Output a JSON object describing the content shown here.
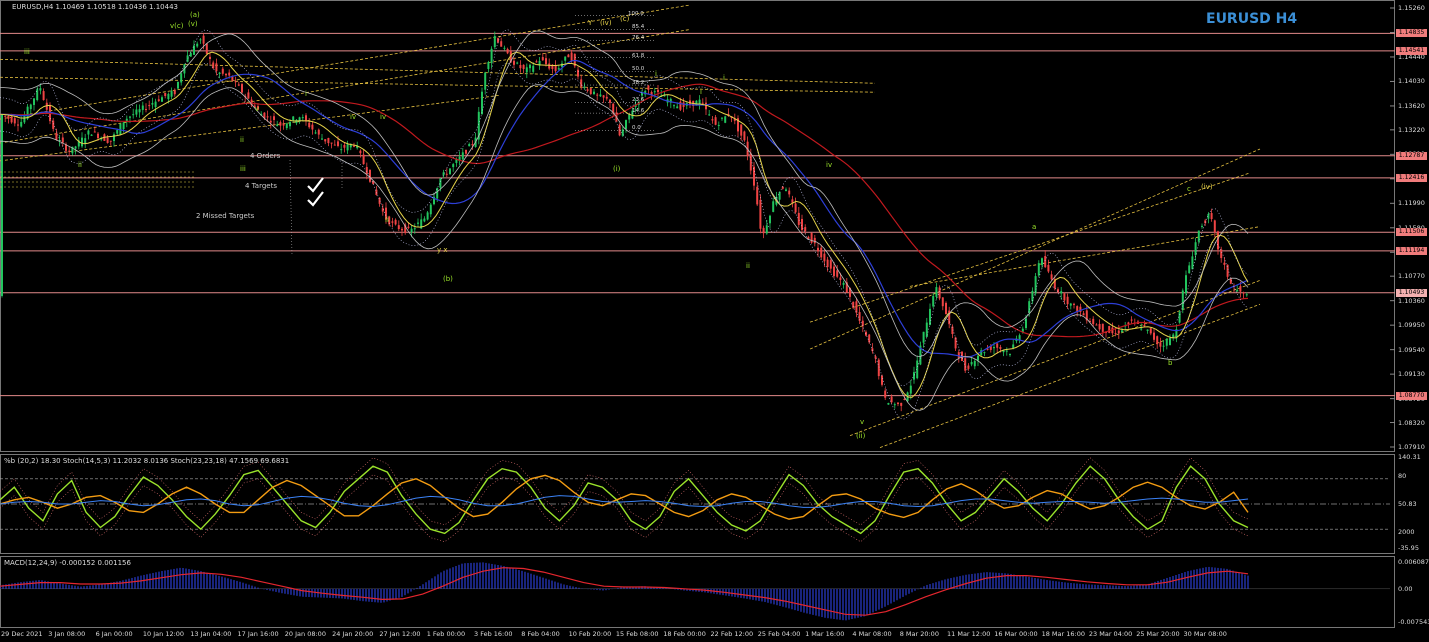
{
  "header": {
    "info": "EURUSD,H4  1.10469 1.10518 1.10436 1.10443",
    "symbol_title": "EURUSD H4"
  },
  "colors": {
    "background": "#000000",
    "bull_candle": "#22c55e",
    "bear_candle": "#ef4444",
    "ma_red": "#c0191e",
    "ma_blue": "#2d3fd8",
    "ma_yellow": "#e5d34a",
    "bollinger": "#bdbdbd",
    "level_line": "#e28a8a",
    "channel": "#e5c040",
    "stoch_main": "#9be32b",
    "stoch_signal": "#f39c12",
    "macd_hist": "#2a3cd0",
    "macd_signal": "#e5262e"
  },
  "chart_data": [
    {
      "type": "candlestick",
      "name": "EURUSD,H4",
      "y_ticks": [
        "1.15260",
        "1.14850",
        "1.14440",
        "1.14030",
        "1.13620",
        "1.13220",
        "1.12810",
        "1.12400",
        "1.11990",
        "1.11580",
        "1.11170",
        "1.10770",
        "1.10360",
        "1.09950",
        "1.09540",
        "1.09130",
        "1.08720",
        "1.08320",
        "1.07910"
      ],
      "ylim": [
        1.0786,
        1.1531
      ],
      "x_ticks": [
        "29 Dec 2021",
        "3 Jan 08:00",
        "6 Jan 00:00",
        "10 Jan 12:00",
        "13 Jan 04:00",
        "17 Jan 16:00",
        "20 Jan 08:00",
        "24 Jan 20:00",
        "27 Jan 12:00",
        "1 Feb 00:00",
        "3 Feb 16:00",
        "8 Feb 04:00",
        "10 Feb 20:00",
        "15 Feb 08:00",
        "18 Feb 00:00",
        "22 Feb 12:00",
        "25 Feb 04:00",
        "1 Mar 16:00",
        "4 Mar 08:00",
        "8 Mar 20:00",
        "11 Mar 12:00",
        "16 Mar 00:00",
        "18 Mar 16:00",
        "23 Mar 04:00",
        "25 Mar 20:00",
        "30 Mar 08:00"
      ],
      "price_tags": [
        {
          "label": "1.14835",
          "value": 1.14835
        },
        {
          "label": "1.14541",
          "value": 1.14541
        },
        {
          "label": "1.12787",
          "value": 1.12787
        },
        {
          "label": "1.12416",
          "value": 1.12416
        },
        {
          "label": "1.11506",
          "value": 1.11506
        },
        {
          "label": "1.11194",
          "value": 1.11194
        },
        {
          "label": "1.10493",
          "value": 1.10493
        },
        {
          "label": "1.08770",
          "value": 1.0877
        }
      ],
      "fib_levels": [
        {
          "label": "100.0",
          "value": 1.1513
        },
        {
          "label": "85.4",
          "value": 1.149
        },
        {
          "label": "76.4",
          "value": 1.1472
        },
        {
          "label": "61.8",
          "value": 1.1443
        },
        {
          "label": "50.0",
          "value": 1.142
        },
        {
          "label": "38.2",
          "value": 1.1397
        },
        {
          "label": "23.6",
          "value": 1.1368
        },
        {
          "label": "14.6",
          "value": 1.135
        },
        {
          "label": "0.0",
          "value": 1.1321
        }
      ],
      "close_path": [
        [
          0,
          1.1348
        ],
        [
          20,
          1.1332
        ],
        [
          40,
          1.1395
        ],
        [
          55,
          1.131
        ],
        [
          70,
          1.1285
        ],
        [
          90,
          1.132
        ],
        [
          110,
          1.1302
        ],
        [
          125,
          1.134
        ],
        [
          140,
          1.1355
        ],
        [
          160,
          1.1375
        ],
        [
          175,
          1.1385
        ],
        [
          185,
          1.144
        ],
        [
          200,
          1.1475
        ],
        [
          215,
          1.142
        ],
        [
          230,
          1.141
        ],
        [
          245,
          1.138
        ],
        [
          260,
          1.135
        ],
        [
          280,
          1.133
        ],
        [
          300,
          1.1345
        ],
        [
          320,
          1.131
        ],
        [
          340,
          1.129
        ],
        [
          355,
          1.13
        ],
        [
          370,
          1.124
        ],
        [
          385,
          1.1175
        ],
        [
          395,
          1.116
        ],
        [
          410,
          1.1152
        ],
        [
          425,
          1.1175
        ],
        [
          440,
          1.124
        ],
        [
          460,
          1.1275
        ],
        [
          475,
          1.1305
        ],
        [
          485,
          1.142
        ],
        [
          495,
          1.148
        ],
        [
          510,
          1.144
        ],
        [
          525,
          1.142
        ],
        [
          540,
          1.144
        ],
        [
          555,
          1.142
        ],
        [
          570,
          1.145
        ],
        [
          580,
          1.14
        ],
        [
          595,
          1.138
        ],
        [
          610,
          1.137
        ],
        [
          620,
          1.131
        ],
        [
          630,
          1.135
        ],
        [
          645,
          1.139
        ],
        [
          660,
          1.138
        ],
        [
          680,
          1.136
        ],
        [
          700,
          1.137
        ],
        [
          715,
          1.133
        ],
        [
          730,
          1.135
        ],
        [
          745,
          1.13
        ],
        [
          755,
          1.1225
        ],
        [
          762,
          1.114
        ],
        [
          775,
          1.121
        ],
        [
          785,
          1.123
        ],
        [
          800,
          1.116
        ],
        [
          815,
          1.113
        ],
        [
          830,
          1.109
        ],
        [
          845,
          1.106
        ],
        [
          860,
          1.1
        ],
        [
          875,
          1.094
        ],
        [
          885,
          1.087
        ],
        [
          900,
          1.086
        ],
        [
          912,
          1.09
        ],
        [
          925,
          1.099
        ],
        [
          935,
          1.106
        ],
        [
          945,
          1.102
        ],
        [
          955,
          1.096
        ],
        [
          965,
          1.092
        ],
        [
          980,
          1.095
        ],
        [
          995,
          1.096
        ],
        [
          1010,
          1.095
        ],
        [
          1025,
          1.1
        ],
        [
          1040,
          1.111
        ],
        [
          1055,
          1.106
        ],
        [
          1070,
          1.103
        ],
        [
          1085,
          1.101
        ],
        [
          1100,
          1.099
        ],
        [
          1115,
          1.098
        ],
        [
          1130,
          1.1
        ],
        [
          1145,
          1.099
        ],
        [
          1160,
          1.096
        ],
        [
          1175,
          1.098
        ],
        [
          1185,
          1.107
        ],
        [
          1200,
          1.116
        ],
        [
          1210,
          1.118
        ],
        [
          1220,
          1.111
        ],
        [
          1232,
          1.106
        ],
        [
          1245,
          1.1044
        ]
      ],
      "annotations": [
        "4 Orders",
        "4 Targets",
        "2 Missed Targets"
      ],
      "wave_labels": [
        "(a)",
        "v(c)",
        "(v)",
        "iii",
        "iv",
        "ii",
        "iii",
        "iv",
        "i",
        "ii",
        "(b)",
        "y x",
        "Y",
        "(iv)",
        "(c)",
        "i",
        "(i)",
        "i",
        "i",
        "ii",
        "iv",
        "v",
        "(ii)",
        "a",
        "b",
        "c",
        "(iv)",
        "ii",
        "v"
      ]
    },
    {
      "type": "line",
      "name": "%b (20,2) 18.30  Stoch(14,5,3) 11.2032 8.0136  Stoch(23,23,18) 47.1569 69.6831",
      "y_ticks": [
        "140.31",
        "80",
        "50.83",
        "2000",
        "-35.95"
      ],
      "series": [
        {
          "name": "stoch_main",
          "values": [
            55,
            70,
            45,
            30,
            62,
            78,
            40,
            22,
            35,
            60,
            82,
            72,
            55,
            35,
            20,
            38,
            60,
            85,
            90,
            70,
            50,
            30,
            22,
            40,
            65,
            80,
            95,
            88,
            60,
            38,
            20,
            15,
            28,
            55,
            80,
            92,
            88,
            70,
            45,
            30,
            48,
            75,
            70,
            55,
            30,
            20,
            35,
            65,
            80,
            60,
            40,
            25,
            18,
            30,
            58,
            85,
            72,
            50,
            35,
            25,
            15,
            30,
            60,
            88,
            92,
            75,
            50,
            30,
            40,
            60,
            80,
            65,
            45,
            30,
            50,
            75,
            95,
            80,
            55,
            35,
            20,
            30,
            70,
            95,
            80,
            50,
            30,
            22
          ]
        },
        {
          "name": "stoch_signal",
          "values": [
            50,
            55,
            58,
            52,
            45,
            50,
            58,
            60,
            52,
            42,
            40,
            50,
            62,
            70,
            62,
            50,
            40,
            40,
            55,
            70,
            78,
            72,
            60,
            48,
            36,
            36,
            48,
            62,
            75,
            80,
            72,
            58,
            45,
            35,
            38,
            52,
            68,
            80,
            84,
            78,
            64,
            52,
            48,
            55,
            62,
            60,
            50,
            40,
            35,
            42,
            55,
            62,
            58,
            48,
            38,
            32,
            35,
            48,
            60,
            62,
            56,
            45,
            38,
            34,
            40,
            55,
            68,
            74,
            66,
            54,
            45,
            48,
            58,
            66,
            62,
            52,
            44,
            48,
            58,
            70,
            76,
            70,
            58,
            48,
            44,
            52,
            64,
            40
          ]
        },
        {
          "name": "stoch_slow",
          "values": [
            50,
            52,
            53,
            52,
            50,
            50,
            52,
            54,
            53,
            50,
            48,
            49,
            52,
            55,
            56,
            54,
            50,
            48,
            49,
            53,
            57,
            59,
            58,
            55,
            51,
            48,
            47,
            49,
            53,
            57,
            59,
            58,
            55,
            51,
            48,
            48,
            50,
            54,
            58,
            60,
            59,
            56,
            53,
            52,
            53,
            54,
            53,
            51,
            48,
            47,
            48,
            51,
            53,
            53,
            51,
            48,
            46,
            46,
            48,
            51,
            53,
            53,
            51,
            48,
            47,
            48,
            51,
            54,
            56,
            56,
            54,
            52,
            51,
            52,
            53,
            53,
            52,
            51,
            52,
            54,
            56,
            57,
            56,
            54,
            52,
            52,
            54,
            56
          ]
        }
      ]
    },
    {
      "type": "bar",
      "name": "MACD(12,24,9) -0.000152 0.001156",
      "y_ticks": [
        "0.006087",
        "0.00",
        "-0.007543"
      ],
      "series": [
        {
          "name": "macd_hist",
          "values": [
            0.0008,
            0.0015,
            0.002,
            0.0012,
            0.0005,
            0.001,
            0.0018,
            0.003,
            0.004,
            0.0048,
            0.004,
            0.0028,
            0.0015,
            0.0,
            -0.001,
            -0.0018,
            -0.002,
            -0.0022,
            -0.0028,
            -0.0032,
            -0.0018,
            0.001,
            0.004,
            0.0058,
            0.006,
            0.0052,
            0.004,
            0.0025,
            0.001,
            0.0,
            -0.0004,
            0.0004,
            0.0006,
            0.0002,
            -0.0004,
            -0.0008,
            -0.0015,
            -0.0022,
            -0.003,
            -0.0042,
            -0.0055,
            -0.0066,
            -0.0072,
            -0.0062,
            -0.004,
            -0.0015,
            0.0008,
            0.0022,
            0.0032,
            0.0038,
            0.0035,
            0.0028,
            0.002,
            0.0014,
            0.001,
            0.0008,
            0.0006,
            0.001,
            0.0025,
            0.004,
            0.005,
            0.0045,
            0.003
          ]
        },
        {
          "name": "macd_signal",
          "values": [
            0.0006,
            0.001,
            0.0014,
            0.0014,
            0.0011,
            0.0011,
            0.0013,
            0.0018,
            0.0025,
            0.0032,
            0.0036,
            0.0033,
            0.0026,
            0.0016,
            0.0006,
            -0.0004,
            -0.001,
            -0.0015,
            -0.0019,
            -0.0024,
            -0.0023,
            -0.0012,
            0.0006,
            0.0026,
            0.004,
            0.0048,
            0.0046,
            0.0038,
            0.0026,
            0.0014,
            0.0006,
            0.0004,
            0.0004,
            0.0003,
            0.0,
            -0.0003,
            -0.0008,
            -0.0014,
            -0.002,
            -0.0028,
            -0.0038,
            -0.0048,
            -0.0058,
            -0.006,
            -0.0052,
            -0.0036,
            -0.0018,
            -0.0002,
            0.0012,
            0.0024,
            0.003,
            0.003,
            0.0026,
            0.0021,
            0.0016,
            0.0012,
            0.0009,
            0.0009,
            0.0015,
            0.0026,
            0.0036,
            0.004,
            0.0034
          ]
        }
      ]
    }
  ]
}
